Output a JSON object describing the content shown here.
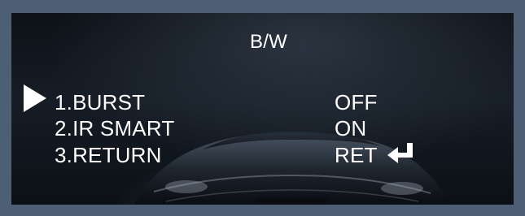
{
  "menu": {
    "title": "B/W",
    "items": [
      {
        "label": "1.BURST",
        "value": "OFF"
      },
      {
        "label": "2.IR SMART",
        "value": "ON"
      },
      {
        "label": "3.RETURN",
        "value": "RET"
      }
    ]
  },
  "cursor_icon": "triangle-right-icon",
  "return_icon": "enter-arrow-icon",
  "colors": {
    "frame": "#4d5f74",
    "text": "#ffffff",
    "background": "#10161e"
  }
}
